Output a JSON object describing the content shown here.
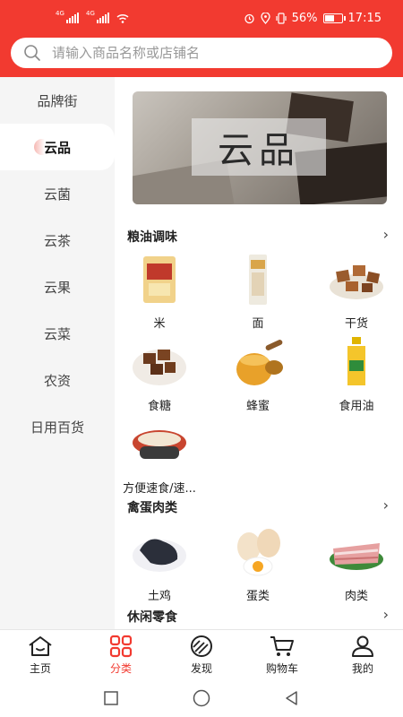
{
  "status_bar": {
    "network_1": "4G",
    "network_2": "4G",
    "battery_percent": "56%",
    "battery_level": 0.56,
    "time": "17:15"
  },
  "search": {
    "placeholder": "请输入商品名称或店铺名"
  },
  "sidebar": {
    "items": [
      "品牌街",
      "云品",
      "云菌",
      "云茶",
      "云果",
      "云菜",
      "农资",
      "日用百货"
    ],
    "active_index": 1
  },
  "banner": {
    "label": "云品"
  },
  "sections": [
    {
      "title": "粮油调味",
      "items": [
        "米",
        "面",
        "干货",
        "食糖",
        "蜂蜜",
        "食用油",
        "方便速食/速..."
      ]
    },
    {
      "title": "禽蛋肉类",
      "items": [
        "土鸡",
        "蛋类",
        "肉类"
      ]
    },
    {
      "title": "休闲零食",
      "items": []
    }
  ],
  "bottom_nav": {
    "items": [
      "主页",
      "分类",
      "发现",
      "购物车",
      "我的"
    ],
    "active_index": 1
  },
  "colors": {
    "accent": "#f23a30",
    "sidebar_bg": "#f5f5f5"
  }
}
